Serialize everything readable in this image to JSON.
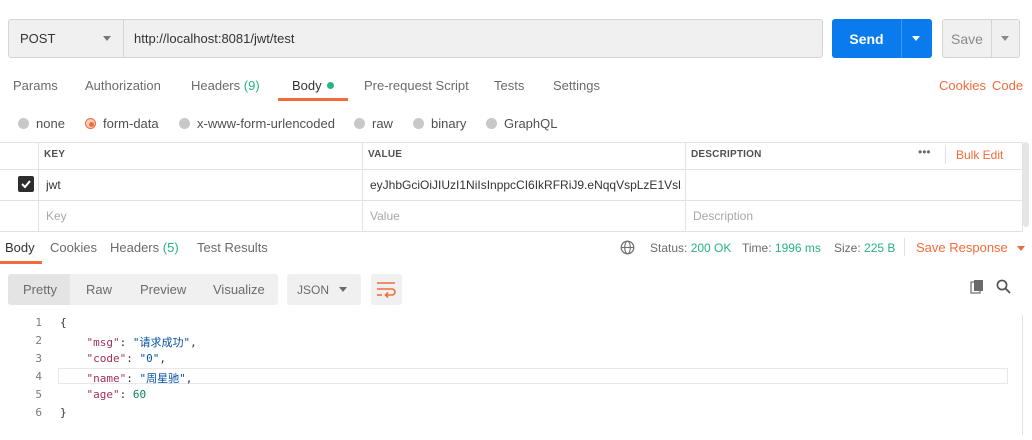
{
  "request": {
    "method": "POST",
    "url": "http://localhost:8081/jwt/test",
    "send_label": "Send",
    "save_label": "Save"
  },
  "req_tabs": {
    "params": "Params",
    "authorization": "Authorization",
    "headers": "Headers",
    "headers_count": "(9)",
    "body": "Body",
    "prerequest": "Pre-request Script",
    "tests": "Tests",
    "settings": "Settings",
    "cookies": "Cookies",
    "code": "Code"
  },
  "body_types": [
    "none",
    "form-data",
    "x-www-form-urlencoded",
    "raw",
    "binary",
    "GraphQL"
  ],
  "body_type_selected": "form-data",
  "table": {
    "headers": {
      "key": "KEY",
      "value": "VALUE",
      "description": "DESCRIPTION",
      "more": "•••",
      "bulk_edit": "Bulk Edit"
    },
    "rows": [
      {
        "key": "jwt",
        "value": "eyJhbGciOiJIUzI1NiIsInppcCI6IkRFRiJ9.eNqqVspLzE1Vsl...",
        "description": ""
      }
    ],
    "placeholders": {
      "key": "Key",
      "value": "Value",
      "description": "Description"
    }
  },
  "response": {
    "tabs": {
      "body": "Body",
      "cookies": "Cookies",
      "headers": "Headers",
      "headers_count": "(5)",
      "test_results": "Test Results"
    },
    "status_label": "Status:",
    "status_value": "200 OK",
    "time_label": "Time:",
    "time_value": "1996 ms",
    "size_label": "Size:",
    "size_value": "225 B",
    "save_response": "Save Response",
    "views": {
      "pretty": "Pretty",
      "raw": "Raw",
      "preview": "Preview",
      "visualize": "Visualize"
    },
    "format": "JSON",
    "line_numbers": [
      "1",
      "2",
      "3",
      "4",
      "5",
      "6"
    ],
    "json": {
      "open": "{",
      "close": "}",
      "msg_key": "\"msg\"",
      "msg_val": "\"请求成功\"",
      "code_key": "\"code\"",
      "code_val": "\"0\"",
      "name_key": "\"name\"",
      "name_val": "\"周星驰\"",
      "age_key": "\"age\"",
      "age_val": "60"
    }
  },
  "colors": {
    "accent": "#f26b3a",
    "send": "#097bed",
    "ok": "#26b47f"
  }
}
